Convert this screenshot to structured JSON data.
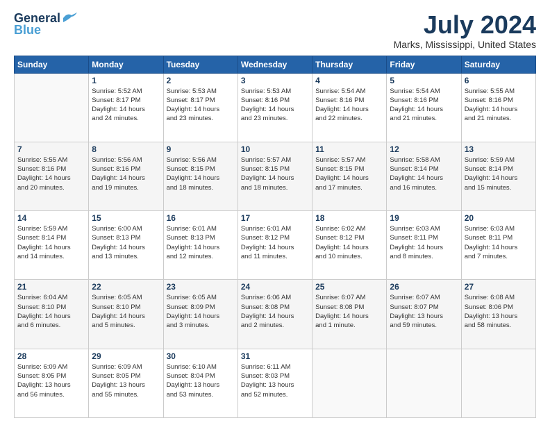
{
  "logo": {
    "line1": "General",
    "line2": "Blue"
  },
  "title": "July 2024",
  "location": "Marks, Mississippi, United States",
  "days_of_week": [
    "Sunday",
    "Monday",
    "Tuesday",
    "Wednesday",
    "Thursday",
    "Friday",
    "Saturday"
  ],
  "weeks": [
    [
      {
        "day": "",
        "info": ""
      },
      {
        "day": "1",
        "info": "Sunrise: 5:52 AM\nSunset: 8:17 PM\nDaylight: 14 hours\nand 24 minutes."
      },
      {
        "day": "2",
        "info": "Sunrise: 5:53 AM\nSunset: 8:17 PM\nDaylight: 14 hours\nand 23 minutes."
      },
      {
        "day": "3",
        "info": "Sunrise: 5:53 AM\nSunset: 8:16 PM\nDaylight: 14 hours\nand 23 minutes."
      },
      {
        "day": "4",
        "info": "Sunrise: 5:54 AM\nSunset: 8:16 PM\nDaylight: 14 hours\nand 22 minutes."
      },
      {
        "day": "5",
        "info": "Sunrise: 5:54 AM\nSunset: 8:16 PM\nDaylight: 14 hours\nand 21 minutes."
      },
      {
        "day": "6",
        "info": "Sunrise: 5:55 AM\nSunset: 8:16 PM\nDaylight: 14 hours\nand 21 minutes."
      }
    ],
    [
      {
        "day": "7",
        "info": "Sunrise: 5:55 AM\nSunset: 8:16 PM\nDaylight: 14 hours\nand 20 minutes."
      },
      {
        "day": "8",
        "info": "Sunrise: 5:56 AM\nSunset: 8:16 PM\nDaylight: 14 hours\nand 19 minutes."
      },
      {
        "day": "9",
        "info": "Sunrise: 5:56 AM\nSunset: 8:15 PM\nDaylight: 14 hours\nand 18 minutes."
      },
      {
        "day": "10",
        "info": "Sunrise: 5:57 AM\nSunset: 8:15 PM\nDaylight: 14 hours\nand 18 minutes."
      },
      {
        "day": "11",
        "info": "Sunrise: 5:57 AM\nSunset: 8:15 PM\nDaylight: 14 hours\nand 17 minutes."
      },
      {
        "day": "12",
        "info": "Sunrise: 5:58 AM\nSunset: 8:14 PM\nDaylight: 14 hours\nand 16 minutes."
      },
      {
        "day": "13",
        "info": "Sunrise: 5:59 AM\nSunset: 8:14 PM\nDaylight: 14 hours\nand 15 minutes."
      }
    ],
    [
      {
        "day": "14",
        "info": "Sunrise: 5:59 AM\nSunset: 8:14 PM\nDaylight: 14 hours\nand 14 minutes."
      },
      {
        "day": "15",
        "info": "Sunrise: 6:00 AM\nSunset: 8:13 PM\nDaylight: 14 hours\nand 13 minutes."
      },
      {
        "day": "16",
        "info": "Sunrise: 6:01 AM\nSunset: 8:13 PM\nDaylight: 14 hours\nand 12 minutes."
      },
      {
        "day": "17",
        "info": "Sunrise: 6:01 AM\nSunset: 8:12 PM\nDaylight: 14 hours\nand 11 minutes."
      },
      {
        "day": "18",
        "info": "Sunrise: 6:02 AM\nSunset: 8:12 PM\nDaylight: 14 hours\nand 10 minutes."
      },
      {
        "day": "19",
        "info": "Sunrise: 6:03 AM\nSunset: 8:11 PM\nDaylight: 14 hours\nand 8 minutes."
      },
      {
        "day": "20",
        "info": "Sunrise: 6:03 AM\nSunset: 8:11 PM\nDaylight: 14 hours\nand 7 minutes."
      }
    ],
    [
      {
        "day": "21",
        "info": "Sunrise: 6:04 AM\nSunset: 8:10 PM\nDaylight: 14 hours\nand 6 minutes."
      },
      {
        "day": "22",
        "info": "Sunrise: 6:05 AM\nSunset: 8:10 PM\nDaylight: 14 hours\nand 5 minutes."
      },
      {
        "day": "23",
        "info": "Sunrise: 6:05 AM\nSunset: 8:09 PM\nDaylight: 14 hours\nand 3 minutes."
      },
      {
        "day": "24",
        "info": "Sunrise: 6:06 AM\nSunset: 8:08 PM\nDaylight: 14 hours\nand 2 minutes."
      },
      {
        "day": "25",
        "info": "Sunrise: 6:07 AM\nSunset: 8:08 PM\nDaylight: 14 hours\nand 1 minute."
      },
      {
        "day": "26",
        "info": "Sunrise: 6:07 AM\nSunset: 8:07 PM\nDaylight: 13 hours\nand 59 minutes."
      },
      {
        "day": "27",
        "info": "Sunrise: 6:08 AM\nSunset: 8:06 PM\nDaylight: 13 hours\nand 58 minutes."
      }
    ],
    [
      {
        "day": "28",
        "info": "Sunrise: 6:09 AM\nSunset: 8:05 PM\nDaylight: 13 hours\nand 56 minutes."
      },
      {
        "day": "29",
        "info": "Sunrise: 6:09 AM\nSunset: 8:05 PM\nDaylight: 13 hours\nand 55 minutes."
      },
      {
        "day": "30",
        "info": "Sunrise: 6:10 AM\nSunset: 8:04 PM\nDaylight: 13 hours\nand 53 minutes."
      },
      {
        "day": "31",
        "info": "Sunrise: 6:11 AM\nSunset: 8:03 PM\nDaylight: 13 hours\nand 52 minutes."
      },
      {
        "day": "",
        "info": ""
      },
      {
        "day": "",
        "info": ""
      },
      {
        "day": "",
        "info": ""
      }
    ]
  ]
}
